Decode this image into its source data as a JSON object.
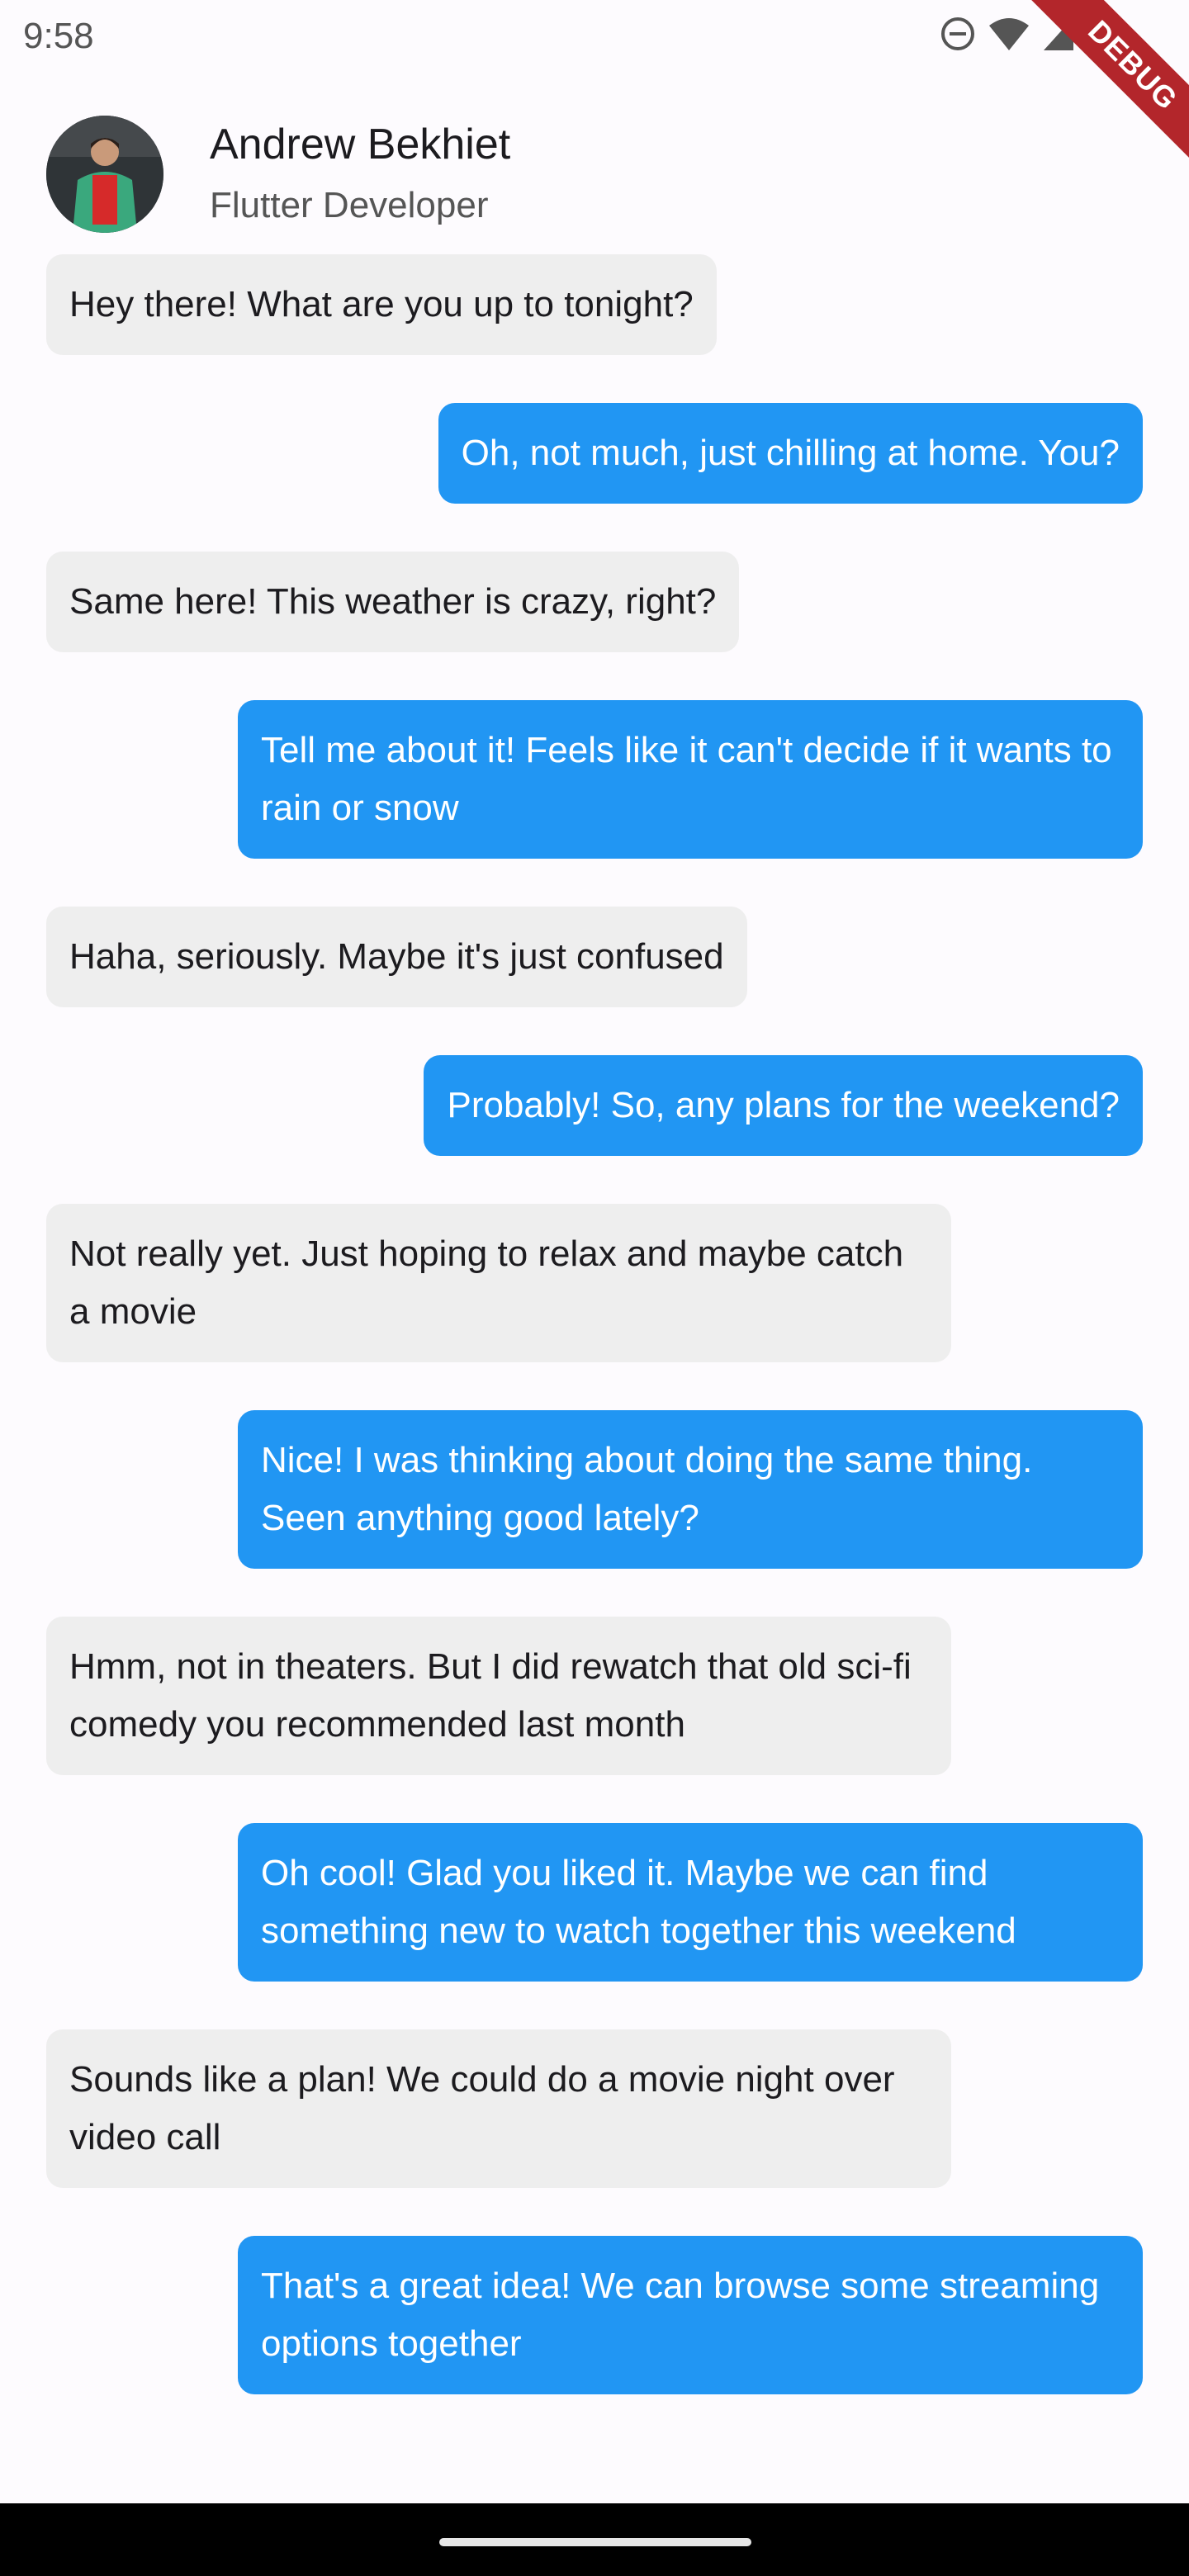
{
  "status_bar": {
    "time": "9:58",
    "icons": [
      "do-not-disturb-icon",
      "wifi-icon",
      "cell-signal-icon",
      "battery-icon"
    ]
  },
  "debug_banner": {
    "label": "DEBUG"
  },
  "header": {
    "name": "Andrew Bekhiet",
    "role": "Flutter Developer"
  },
  "colors": {
    "outgoing_bubble": "#2196f3",
    "incoming_bubble": "#eeeeee",
    "background": "#fdfbfe"
  },
  "messages": [
    {
      "from": "other",
      "text": "Hey there! What are you up to tonight?"
    },
    {
      "from": "me",
      "text": "Oh, not much, just chilling at home. You?"
    },
    {
      "from": "other",
      "text": "Same here! This weather is crazy, right?"
    },
    {
      "from": "me",
      "text": "Tell me about it! Feels like it can't decide if it wants to rain or snow"
    },
    {
      "from": "other",
      "text": "Haha, seriously. Maybe it's just confused"
    },
    {
      "from": "me",
      "text": "Probably! So, any plans for the weekend?"
    },
    {
      "from": "other",
      "text": "Not really yet. Just hoping to relax and maybe catch a movie"
    },
    {
      "from": "me",
      "text": "Nice! I was thinking about doing the same thing. Seen anything good lately?"
    },
    {
      "from": "other",
      "text": "Hmm, not in theaters. But I did rewatch that old sci-fi comedy you recommended last month"
    },
    {
      "from": "me",
      "text": "Oh cool! Glad you liked it. Maybe we can find something new to watch together this weekend"
    },
    {
      "from": "other",
      "text": "Sounds like a plan! We could do a movie night over video call"
    },
    {
      "from": "me",
      "text": "That's a great idea! We can browse some streaming options together"
    }
  ]
}
